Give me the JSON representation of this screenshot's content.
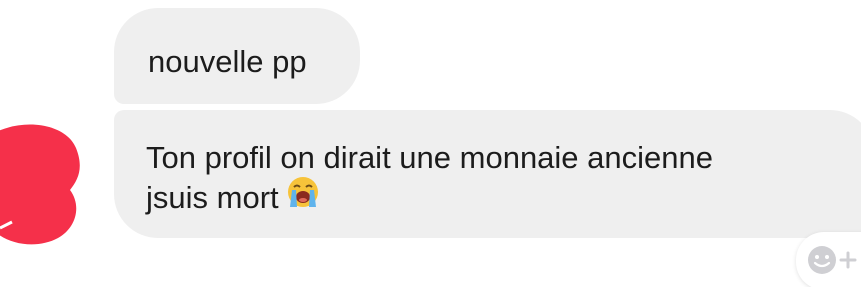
{
  "messages": [
    {
      "text": "nouvelle pp"
    },
    {
      "lines": [
        "Ton profil on dirait une monnaie ancienne",
        "jsuis mort"
      ],
      "emoji": "loudly-crying-face"
    }
  ],
  "reaction_button": {
    "icon": "add-reaction-icon"
  },
  "colors": {
    "bubble": "#efefef",
    "text": "#1c1c1c",
    "avatar_redaction": "#f5304a",
    "reaction_icon": "#cfcfd3"
  }
}
